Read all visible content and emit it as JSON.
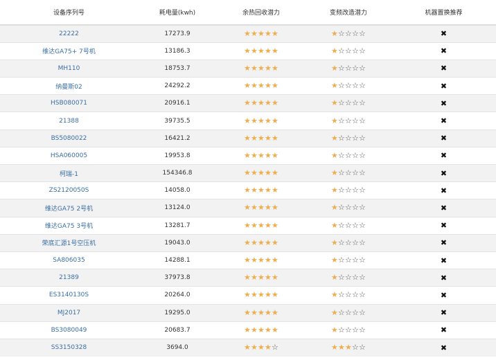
{
  "colors": {
    "star_filled": "#f0ad4e",
    "star_empty": "#555555",
    "link": "#3a6ea5",
    "row_stripe": "#f2f2f2"
  },
  "table": {
    "headers": [
      "设备序列号",
      "耗电量(kwh)",
      "余热回收潜力",
      "变频改造潜力",
      "机器置换推荐"
    ],
    "max_stars": 5,
    "rows": [
      {
        "serial": "22222",
        "power": "17273.9",
        "heat_recovery": 5,
        "vfd_retrofit": 1,
        "replace": "✖"
      },
      {
        "serial": "维达GA75+ 7号机",
        "power": "13186.3",
        "heat_recovery": 5,
        "vfd_retrofit": 1,
        "replace": "✖"
      },
      {
        "serial": "MH110",
        "power": "18753.7",
        "heat_recovery": 5,
        "vfd_retrofit": 1,
        "replace": "✖"
      },
      {
        "serial": "纳曼斯02",
        "power": "24292.2",
        "heat_recovery": 5,
        "vfd_retrofit": 1,
        "replace": "✖"
      },
      {
        "serial": "HSB080071",
        "power": "20916.1",
        "heat_recovery": 5,
        "vfd_retrofit": 1,
        "replace": "✖"
      },
      {
        "serial": "21388",
        "power": "39735.5",
        "heat_recovery": 5,
        "vfd_retrofit": 1,
        "replace": "✖"
      },
      {
        "serial": "BS5080022",
        "power": "16421.2",
        "heat_recovery": 5,
        "vfd_retrofit": 1,
        "replace": "✖"
      },
      {
        "serial": "HSA060005",
        "power": "19953.8",
        "heat_recovery": 5,
        "vfd_retrofit": 1,
        "replace": "✖"
      },
      {
        "serial": "柯瑞-1",
        "power": "154346.8",
        "heat_recovery": 5,
        "vfd_retrofit": 1,
        "replace": "✖"
      },
      {
        "serial": "ZS2120050S",
        "power": "14058.0",
        "heat_recovery": 5,
        "vfd_retrofit": 1,
        "replace": "✖"
      },
      {
        "serial": "维达GA75 2号机",
        "power": "13124.0",
        "heat_recovery": 5,
        "vfd_retrofit": 1,
        "replace": "✖"
      },
      {
        "serial": "维达GA75 3号机",
        "power": "13281.7",
        "heat_recovery": 5,
        "vfd_retrofit": 1,
        "replace": "✖"
      },
      {
        "serial": "荣底汇源1号空压机",
        "power": "19043.0",
        "heat_recovery": 5,
        "vfd_retrofit": 1,
        "replace": "✖"
      },
      {
        "serial": "SA806035",
        "power": "14288.1",
        "heat_recovery": 5,
        "vfd_retrofit": 1,
        "replace": "✖"
      },
      {
        "serial": "21389",
        "power": "37973.8",
        "heat_recovery": 5,
        "vfd_retrofit": 1,
        "replace": "✖"
      },
      {
        "serial": "ES3140130S",
        "power": "20264.0",
        "heat_recovery": 5,
        "vfd_retrofit": 1,
        "replace": "✖"
      },
      {
        "serial": "MJ2017",
        "power": "19295.0",
        "heat_recovery": 5,
        "vfd_retrofit": 1,
        "replace": "✖"
      },
      {
        "serial": "BS3080049",
        "power": "20683.7",
        "heat_recovery": 5,
        "vfd_retrofit": 1,
        "replace": "✖"
      },
      {
        "serial": "SS3150328",
        "power": "3694.0",
        "heat_recovery": 4,
        "vfd_retrofit": 3,
        "replace": "✖"
      }
    ]
  }
}
